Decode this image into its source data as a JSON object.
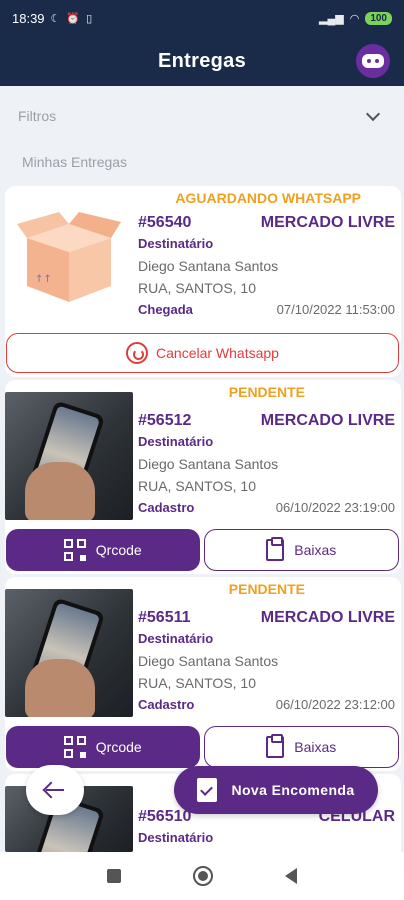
{
  "status_bar": {
    "time": "18:39",
    "battery": "100"
  },
  "app_bar": {
    "title": "Entregas"
  },
  "filters": {
    "label": "Filtros"
  },
  "section": {
    "title": "Minhas Entregas"
  },
  "deliveries": [
    {
      "status": "AGUARDANDO WHATSAPP",
      "id": "#56540",
      "carrier": "MERCADO LIVRE",
      "recipient_label": "Destinatário",
      "recipient": "Diego Santana Santos",
      "address": "RUA, SANTOS, 10",
      "date_label": "Chegada",
      "date": "07/10/2022 11:53:00",
      "action_label": "Cancelar Whatsapp"
    },
    {
      "status": "PENDENTE",
      "id": "#56512",
      "carrier": "MERCADO LIVRE",
      "recipient_label": "Destinatário",
      "recipient": "Diego Santana Santos",
      "address": "RUA, SANTOS, 10",
      "date_label": "Cadastro",
      "date": "06/10/2022 23:19:00",
      "qr_label": "Qrcode",
      "baixas_label": "Baixas"
    },
    {
      "status": "PENDENTE",
      "id": "#56511",
      "carrier": "MERCADO LIVRE",
      "recipient_label": "Destinatário",
      "recipient": "Diego Santana Santos",
      "address": "RUA, SANTOS, 10",
      "date_label": "Cadastro",
      "date": "06/10/2022 23:12:00",
      "qr_label": "Qrcode",
      "baixas_label": "Baixas"
    },
    {
      "id": "#56510",
      "carrier": "CELULAR",
      "recipient_label": "Destinatário"
    }
  ],
  "fab": {
    "new_label": "Nova Encomenda"
  },
  "colors": {
    "primary": "#5b2a86",
    "header": "#1a2b4a",
    "status_warning": "#f0a020",
    "danger": "#e23b3b"
  }
}
